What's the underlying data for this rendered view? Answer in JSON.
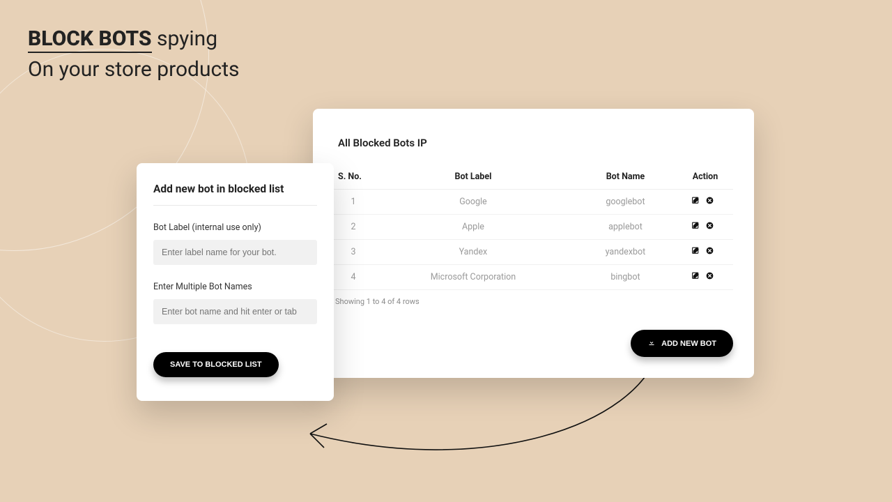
{
  "headline": {
    "bold": "BLOCK BOTS",
    "rest1": " spying",
    "line2": "On your store products"
  },
  "form": {
    "title": "Add new bot in blocked list",
    "label_botlabel": "Bot Label (internal use only)",
    "placeholder_botlabel": "Enter label name for your bot.",
    "label_botnames": "Enter Multiple Bot Names",
    "placeholder_botnames": "Enter bot name and hit enter or tab",
    "save_button": "SAVE TO BLOCKED LIST"
  },
  "table": {
    "title": "All Blocked Bots IP",
    "headers": {
      "sno": "S. No.",
      "label": "Bot Label",
      "name": "Bot Name",
      "action": "Action"
    },
    "rows": [
      {
        "sno": "1",
        "label": "Google",
        "name": "googlebot"
      },
      {
        "sno": "2",
        "label": "Apple",
        "name": "applebot"
      },
      {
        "sno": "3",
        "label": "Yandex",
        "name": "yandexbot"
      },
      {
        "sno": "4",
        "label": "Microsoft Corporation",
        "name": "bingbot"
      }
    ],
    "paging": "Showing 1 to 4 of 4 rows",
    "add_button": "ADD NEW BOT"
  }
}
